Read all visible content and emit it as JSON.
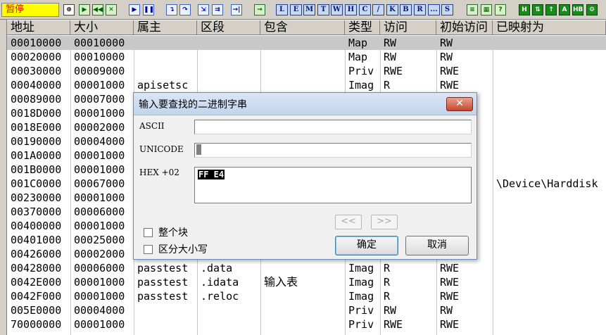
{
  "toolbar": {
    "status": "暂停",
    "buttons": [
      {
        "name": "open-icon",
        "glyph": "⊕",
        "style": ""
      },
      {
        "name": "restart-icon",
        "glyph": "▶",
        "style": "green"
      },
      {
        "name": "close-program-icon",
        "glyph": "◀◀",
        "style": "green"
      },
      {
        "name": "terminate-icon",
        "glyph": "✕",
        "style": "green"
      },
      {
        "name": "run-icon",
        "glyph": "▶",
        "style": "blue2"
      },
      {
        "name": "pause-icon",
        "glyph": "❚❚",
        "style": "blue2"
      },
      {
        "name": "step-into-icon",
        "glyph": "↴",
        "style": "blue2"
      },
      {
        "name": "step-over-icon",
        "glyph": "↷",
        "style": "blue2"
      },
      {
        "name": "trace-into-icon",
        "glyph": "⇲",
        "style": "blue2"
      },
      {
        "name": "trace-over-icon",
        "glyph": "⇉",
        "style": "blue2"
      },
      {
        "name": "execute-till-return-icon",
        "glyph": "→|",
        "style": "blue2"
      },
      {
        "name": "go-to-icon",
        "glyph": "→",
        "style": "green"
      }
    ],
    "window_buttons": [
      "L",
      "E",
      "M",
      "T",
      "W",
      "H",
      "C",
      "/",
      "K",
      "B",
      "R",
      "...",
      "S"
    ],
    "right_buttons": [
      {
        "name": "list-icon",
        "glyph": "≡",
        "style": "green"
      },
      {
        "name": "grid-icon",
        "glyph": "▦",
        "style": "green"
      },
      {
        "name": "help-icon",
        "glyph": "?",
        "style": "green"
      },
      {
        "name": "plugin-h-icon",
        "glyph": "H",
        "style": "dark"
      },
      {
        "name": "plugin-swap-icon",
        "glyph": "⇅",
        "style": "dark"
      },
      {
        "name": "plugin-a1-icon",
        "glyph": "↑",
        "style": "dark"
      },
      {
        "name": "plugin-a-icon",
        "glyph": "A",
        "style": "dark"
      },
      {
        "name": "plugin-hb-icon",
        "glyph": "HB",
        "style": "dark"
      },
      {
        "name": "plugin-lock-icon",
        "glyph": "⚙",
        "style": "dark"
      },
      {
        "name": "plugin-clip-icon",
        "glyph": "✎",
        "style": "dark"
      }
    ]
  },
  "table": {
    "columns": [
      "地址",
      "大小",
      "属主",
      "区段",
      "包含",
      "类型",
      "访问",
      "初始访问",
      "已映射为"
    ],
    "rows": [
      {
        "address": "00010000",
        "size": "00010000",
        "owner": "",
        "section": "",
        "contains": "",
        "type": "Map",
        "access": "RW",
        "initial": "RW",
        "mapped": "",
        "selected": true
      },
      {
        "address": "00020000",
        "size": "00010000",
        "owner": "",
        "section": "",
        "contains": "",
        "type": "Map",
        "access": "RW",
        "initial": "RW",
        "mapped": ""
      },
      {
        "address": "00030000",
        "size": "00009000",
        "owner": "",
        "section": "",
        "contains": "",
        "type": "Priv",
        "access": "RWE",
        "initial": "RWE",
        "mapped": ""
      },
      {
        "address": "00040000",
        "size": "00001000",
        "owner": "apisetsc",
        "section": "",
        "contains": "",
        "type": "Imag",
        "access": "R",
        "initial": "RWE",
        "mapped": ""
      },
      {
        "address": "00089000",
        "size": "00007000",
        "owner": "",
        "section": "",
        "contains": "",
        "type": "",
        "access": "",
        "initial": "",
        "mapped": ""
      },
      {
        "address": "0018D000",
        "size": "00001000",
        "owner": "",
        "section": "",
        "contains": "",
        "type": "",
        "access": "",
        "initial": "",
        "mapped": ""
      },
      {
        "address": "0018E000",
        "size": "00002000",
        "owner": "",
        "section": "",
        "contains": "",
        "type": "",
        "access": "",
        "initial": "",
        "mapped": ""
      },
      {
        "address": "00190000",
        "size": "00004000",
        "owner": "",
        "section": "",
        "contains": "",
        "type": "",
        "access": "",
        "initial": "",
        "mapped": ""
      },
      {
        "address": "001A0000",
        "size": "00001000",
        "owner": "",
        "section": "",
        "contains": "",
        "type": "",
        "access": "",
        "initial": "",
        "mapped": ""
      },
      {
        "address": "001B0000",
        "size": "00001000",
        "owner": "",
        "section": "",
        "contains": "",
        "type": "",
        "access": "",
        "initial": "",
        "mapped": ""
      },
      {
        "address": "001C0000",
        "size": "00067000",
        "owner": "",
        "section": "",
        "contains": "",
        "type": "",
        "access": "",
        "initial": "",
        "mapped": "\\Device\\Harddisk"
      },
      {
        "address": "00230000",
        "size": "00001000",
        "owner": "",
        "section": "",
        "contains": "",
        "type": "",
        "access": "",
        "initial": "",
        "mapped": ""
      },
      {
        "address": "00370000",
        "size": "00006000",
        "owner": "",
        "section": "",
        "contains": "",
        "type": "",
        "access": "",
        "initial": "",
        "mapped": ""
      },
      {
        "address": "00400000",
        "size": "00001000",
        "owner": "",
        "section": "",
        "contains": "",
        "type": "",
        "access": "",
        "initial": "",
        "mapped": ""
      },
      {
        "address": "00401000",
        "size": "00025000",
        "owner": "",
        "section": "",
        "contains": "",
        "type": "",
        "access": "",
        "initial": "",
        "mapped": ""
      },
      {
        "address": "00426000",
        "size": "00002000",
        "owner": "",
        "section": "",
        "contains": "",
        "type": "",
        "access": "",
        "initial": "",
        "mapped": ""
      },
      {
        "address": "00428000",
        "size": "00006000",
        "owner": "passtest",
        "section": ".data",
        "contains": "",
        "type": "Imag",
        "access": "R",
        "initial": "RWE",
        "mapped": ""
      },
      {
        "address": "0042E000",
        "size": "00001000",
        "owner": "passtest",
        "section": ".idata",
        "contains": "输入表",
        "type": "Imag",
        "access": "R",
        "initial": "RWE",
        "mapped": ""
      },
      {
        "address": "0042F000",
        "size": "00001000",
        "owner": "passtest",
        "section": ".reloc",
        "contains": "",
        "type": "Imag",
        "access": "R",
        "initial": "RWE",
        "mapped": ""
      },
      {
        "address": "005E0000",
        "size": "00004000",
        "owner": "",
        "section": "",
        "contains": "",
        "type": "Priv",
        "access": "RW",
        "initial": "RW",
        "mapped": ""
      },
      {
        "address": "70000000",
        "size": "00001000",
        "owner": "",
        "section": "",
        "contains": "",
        "type": "Priv",
        "access": "RWE",
        "initial": "RWE",
        "mapped": ""
      }
    ]
  },
  "dialog": {
    "title": "输入要查找的二进制字串",
    "close_label": "✕",
    "ascii_label": "ASCII",
    "ascii_value": "",
    "unicode_label": "UNICODE",
    "unicode_value": "",
    "hex_label": "HEX +02",
    "hex_value": "FF E4",
    "prev_label": "<<",
    "next_label": ">>",
    "whole_block_label": "整个块",
    "case_sensitive_label": "区分大小写",
    "ok_label": "确定",
    "cancel_label": "取消"
  }
}
